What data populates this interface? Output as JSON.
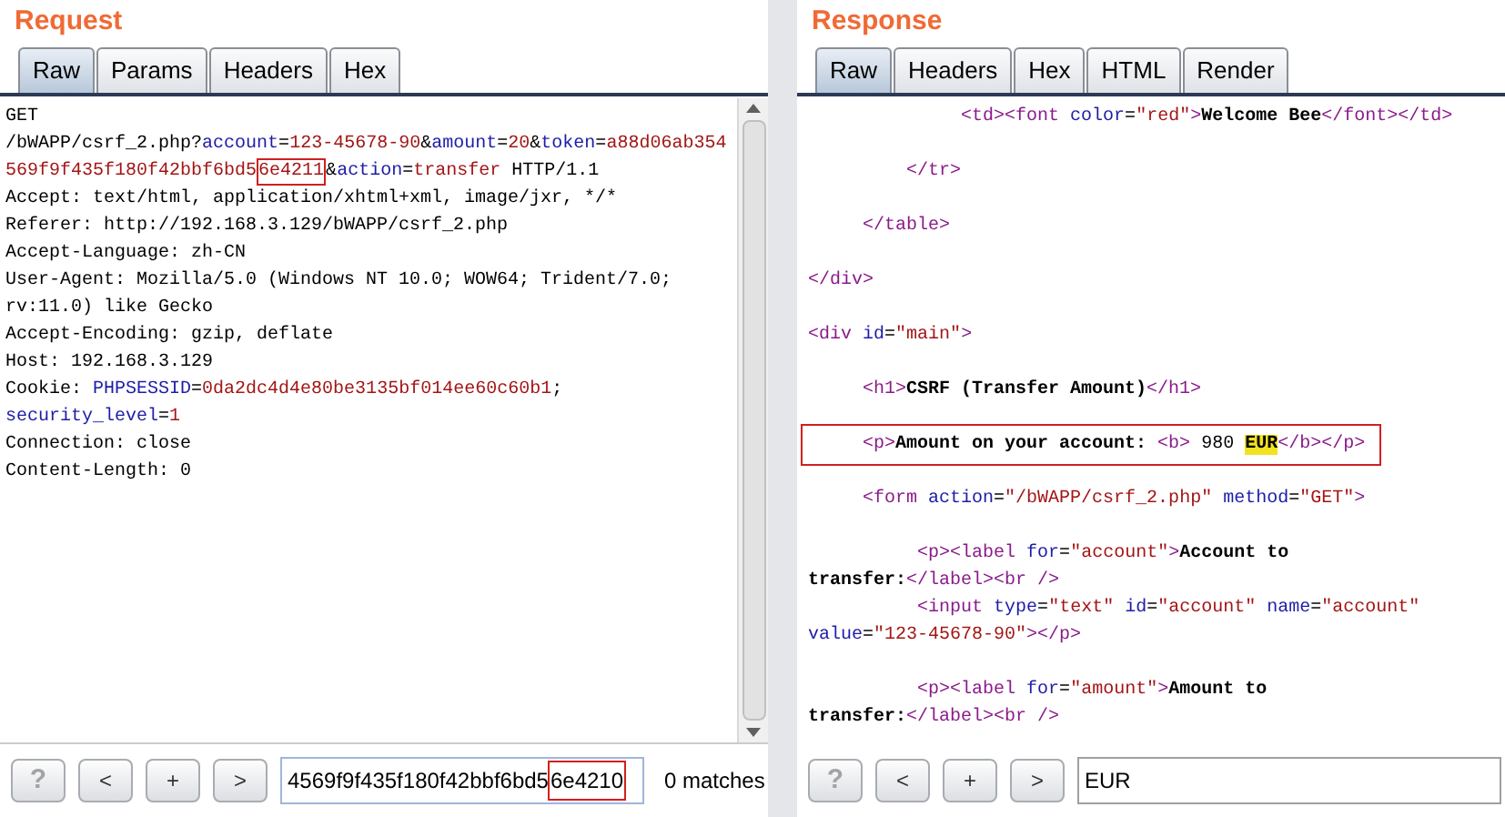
{
  "panels": [
    {
      "title": "Request",
      "tabs": [
        {
          "label": "Raw",
          "selected": true
        },
        {
          "label": "Params",
          "selected": false
        },
        {
          "label": "Headers",
          "selected": false
        },
        {
          "label": "Hex",
          "selected": false
        }
      ],
      "lines": [
        {
          "kind": "code",
          "segments": [
            {
              "text": "GET",
              "kind": "plain"
            }
          ]
        },
        {
          "kind": "code",
          "segments": [
            {
              "text": "/bWAPP/csrf_2.php?",
              "kind": "plain"
            },
            {
              "text": "account",
              "kind": "name"
            },
            {
              "text": "=",
              "kind": "plain"
            },
            {
              "text": "123-45678-90",
              "kind": "value"
            },
            {
              "text": "&",
              "kind": "plain"
            },
            {
              "text": "amount",
              "kind": "name"
            },
            {
              "text": "=",
              "kind": "plain"
            },
            {
              "text": "20",
              "kind": "value"
            },
            {
              "text": "&",
              "kind": "plain"
            },
            {
              "text": "token",
              "kind": "name"
            },
            {
              "text": "=",
              "kind": "plain"
            },
            {
              "text": "a88d06ab354",
              "kind": "value"
            }
          ]
        },
        {
          "kind": "code",
          "segments": [
            {
              "text": "569f9f435f180f42bbf6bd5",
              "kind": "value"
            },
            {
              "text": "6e4211",
              "kind": "value",
              "boxed": true
            },
            {
              "text": "&",
              "kind": "plain"
            },
            {
              "text": "action",
              "kind": "name"
            },
            {
              "text": "=",
              "kind": "plain"
            },
            {
              "text": "transfer",
              "kind": "value"
            },
            {
              "text": " HTTP/1.1",
              "kind": "plain"
            }
          ]
        },
        {
          "kind": "code",
          "segments": [
            {
              "text": "Accept: text/html, application/xhtml+xml, image/jxr, */*",
              "kind": "plain"
            }
          ]
        },
        {
          "kind": "code",
          "segments": [
            {
              "text": "Referer: http://192.168.3.129/bWAPP/csrf_2.php",
              "kind": "plain"
            }
          ]
        },
        {
          "kind": "code",
          "segments": [
            {
              "text": "Accept-Language: zh-CN",
              "kind": "plain"
            }
          ]
        },
        {
          "kind": "code",
          "segments": [
            {
              "text": "User-Agent: Mozilla/5.0 (Windows NT 10.0; WOW64; Trident/7.0;",
              "kind": "plain"
            }
          ]
        },
        {
          "kind": "code",
          "segments": [
            {
              "text": "rv:11.0) like Gecko",
              "kind": "plain"
            }
          ]
        },
        {
          "kind": "code",
          "segments": [
            {
              "text": "Accept-Encoding: gzip, deflate",
              "kind": "plain"
            }
          ]
        },
        {
          "kind": "code",
          "segments": [
            {
              "text": "Host: 192.168.3.129",
              "kind": "plain"
            }
          ]
        },
        {
          "kind": "code",
          "segments": [
            {
              "text": "Cookie: ",
              "kind": "plain"
            },
            {
              "text": "PHPSESSID",
              "kind": "name"
            },
            {
              "text": "=",
              "kind": "plain"
            },
            {
              "text": "0da2dc4d4e80be3135bf014ee60c60b1",
              "kind": "value"
            },
            {
              "text": ";",
              "kind": "plain"
            }
          ]
        },
        {
          "kind": "code",
          "segments": [
            {
              "text": "security_level",
              "kind": "name"
            },
            {
              "text": "=",
              "kind": "plain"
            },
            {
              "text": "1",
              "kind": "value"
            }
          ]
        },
        {
          "kind": "code",
          "segments": [
            {
              "text": "Connection: close",
              "kind": "plain"
            }
          ]
        },
        {
          "kind": "code",
          "segments": [
            {
              "text": "Content-Length: 0",
              "kind": "plain"
            }
          ]
        }
      ],
      "buttons": [
        {
          "label": "?",
          "disabled": true
        },
        {
          "label": "<",
          "disabled": false
        },
        {
          "label": "+",
          "disabled": false
        },
        {
          "label": ">",
          "disabled": false
        }
      ],
      "search": [
        {
          "text": "4569f9f435f180f42bbf6bd5",
          "boxed": false
        },
        {
          "text": "6e4210",
          "boxed": true
        }
      ],
      "matches": "0 matches"
    },
    {
      "title": "Response",
      "tabs": [
        {
          "label": "Raw",
          "selected": true
        },
        {
          "label": "Headers",
          "selected": false
        },
        {
          "label": "Hex",
          "selected": false
        },
        {
          "label": "HTML",
          "selected": false
        },
        {
          "label": "Render",
          "selected": false
        }
      ],
      "lines": [
        {
          "kind": "code",
          "segments": [
            {
              "text": "              <td><font ",
              "kind": "tag"
            },
            {
              "text": "color",
              "kind": "attr"
            },
            {
              "text": "=",
              "kind": "plain"
            },
            {
              "text": "\"red\"",
              "kind": "value"
            },
            {
              "text": ">",
              "kind": "tag"
            },
            {
              "text": "Welcome Bee",
              "kind": "text"
            },
            {
              "text": "</font></td>",
              "kind": "tag"
            }
          ]
        },
        {
          "kind": "blank"
        },
        {
          "kind": "code",
          "segments": [
            {
              "text": "         </tr>",
              "kind": "tag"
            }
          ]
        },
        {
          "kind": "blank"
        },
        {
          "kind": "code",
          "segments": [
            {
              "text": "     </table>",
              "kind": "tag"
            }
          ]
        },
        {
          "kind": "blank"
        },
        {
          "kind": "code",
          "segments": [
            {
              "text": "</div>",
              "kind": "tag"
            }
          ]
        },
        {
          "kind": "blank"
        },
        {
          "kind": "code",
          "segments": [
            {
              "text": "<div ",
              "kind": "tag"
            },
            {
              "text": "id",
              "kind": "attr"
            },
            {
              "text": "=",
              "kind": "plain"
            },
            {
              "text": "\"main\"",
              "kind": "value"
            },
            {
              "text": ">",
              "kind": "tag"
            }
          ]
        },
        {
          "kind": "blank"
        },
        {
          "kind": "code",
          "segments": [
            {
              "text": "     <h1>",
              "kind": "tag"
            },
            {
              "text": "CSRF (Transfer Amount)",
              "kind": "text"
            },
            {
              "text": "</h1>",
              "kind": "tag"
            }
          ]
        },
        {
          "kind": "blank"
        },
        {
          "kind": "code",
          "boxed": true,
          "segments": [
            {
              "text": "     <p>",
              "kind": "tag"
            },
            {
              "text": "Amount on your account: ",
              "kind": "text"
            },
            {
              "text": "<b>",
              "kind": "tag"
            },
            {
              "text": " 980 ",
              "kind": "plain"
            },
            {
              "text": "EUR",
              "kind": "text",
              "highlighted": true
            },
            {
              "text": "</b></p>",
              "kind": "tag"
            }
          ]
        },
        {
          "kind": "blank"
        },
        {
          "kind": "code",
          "segments": [
            {
              "text": "     <form ",
              "kind": "tag"
            },
            {
              "text": "action",
              "kind": "attr"
            },
            {
              "text": "=",
              "kind": "plain"
            },
            {
              "text": "\"/bWAPP/csrf_2.php\"",
              "kind": "value"
            },
            {
              "text": " method",
              "kind": "attr"
            },
            {
              "text": "=",
              "kind": "plain"
            },
            {
              "text": "\"GET\"",
              "kind": "value"
            },
            {
              "text": ">",
              "kind": "tag"
            }
          ]
        },
        {
          "kind": "blank"
        },
        {
          "kind": "code",
          "segments": [
            {
              "text": "          <p><label ",
              "kind": "tag"
            },
            {
              "text": "for",
              "kind": "attr"
            },
            {
              "text": "=",
              "kind": "plain"
            },
            {
              "text": "\"account\"",
              "kind": "value"
            },
            {
              "text": ">",
              "kind": "tag"
            },
            {
              "text": "Account to",
              "kind": "text"
            }
          ]
        },
        {
          "kind": "code",
          "segments": [
            {
              "text": "transfer:",
              "kind": "text"
            },
            {
              "text": "</label><br />",
              "kind": "tag"
            }
          ]
        },
        {
          "kind": "code",
          "segments": [
            {
              "text": "          <input ",
              "kind": "tag"
            },
            {
              "text": "type",
              "kind": "attr"
            },
            {
              "text": "=",
              "kind": "plain"
            },
            {
              "text": "\"text\"",
              "kind": "value"
            },
            {
              "text": " id",
              "kind": "attr"
            },
            {
              "text": "=",
              "kind": "plain"
            },
            {
              "text": "\"account\"",
              "kind": "value"
            },
            {
              "text": " name",
              "kind": "attr"
            },
            {
              "text": "=",
              "kind": "plain"
            },
            {
              "text": "\"account\"",
              "kind": "value"
            }
          ]
        },
        {
          "kind": "code",
          "segments": [
            {
              "text": "value",
              "kind": "attr"
            },
            {
              "text": "=",
              "kind": "plain"
            },
            {
              "text": "\"123-45678-90\"",
              "kind": "value"
            },
            {
              "text": "></p>",
              "kind": "tag"
            }
          ]
        },
        {
          "kind": "blank"
        },
        {
          "kind": "code",
          "segments": [
            {
              "text": "          <p><label ",
              "kind": "tag"
            },
            {
              "text": "for",
              "kind": "attr"
            },
            {
              "text": "=",
              "kind": "plain"
            },
            {
              "text": "\"amount\"",
              "kind": "value"
            },
            {
              "text": ">",
              "kind": "tag"
            },
            {
              "text": "Amount to",
              "kind": "text"
            }
          ]
        },
        {
          "kind": "code",
          "segments": [
            {
              "text": "transfer:",
              "kind": "text"
            },
            {
              "text": "</label><br />",
              "kind": "tag"
            }
          ]
        }
      ],
      "buttons": [
        {
          "label": "?",
          "disabled": true
        },
        {
          "label": "<",
          "disabled": false
        },
        {
          "label": "+",
          "disabled": false
        },
        {
          "label": ">",
          "disabled": false
        }
      ],
      "search": [
        {
          "text": "EUR",
          "boxed": false
        }
      ]
    }
  ]
}
